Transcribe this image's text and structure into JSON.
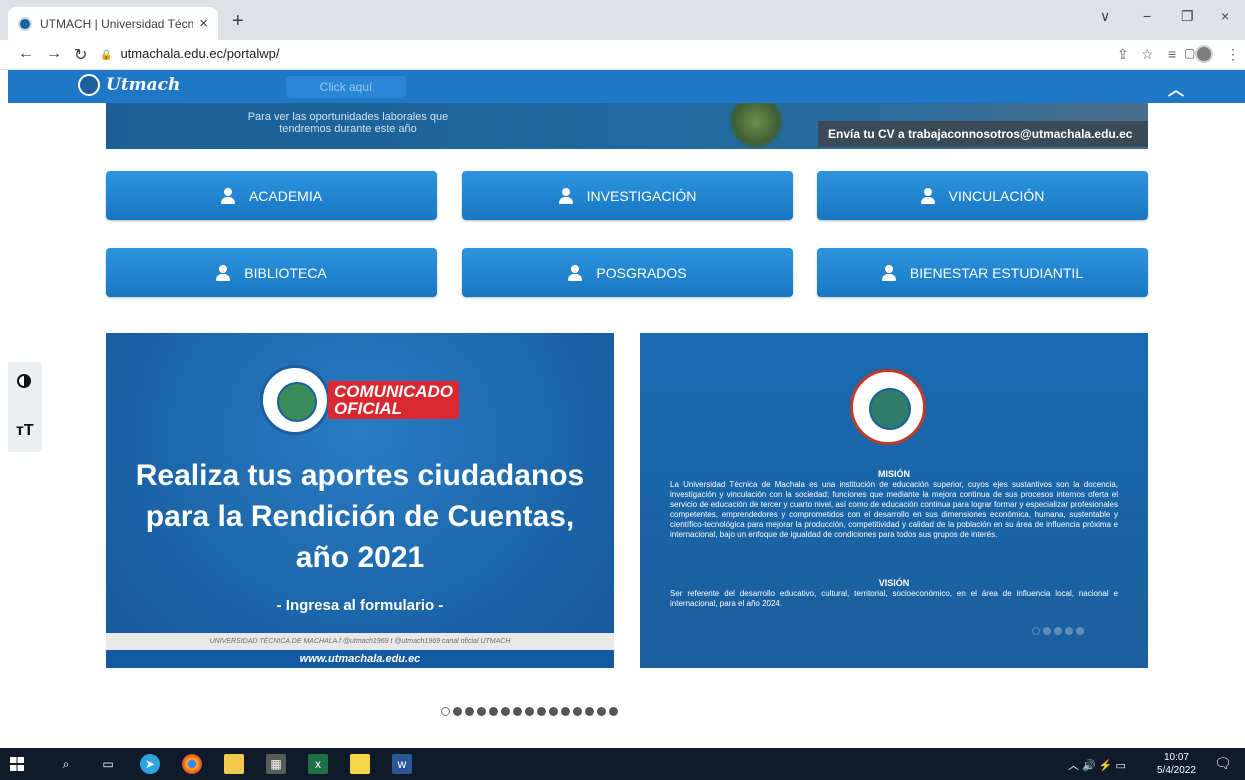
{
  "browser": {
    "tab_title": "UTMACH | Universidad Técnica d",
    "tab_close": "×",
    "new_tab": "+",
    "url": "utmachala.edu.ec/portalwp/",
    "window_controls": [
      "∨",
      "−",
      "❐",
      "×"
    ]
  },
  "site": {
    "logo_text": "Utmach",
    "click_aqui": "Click aquí",
    "collapse_icon": "chevron-up-icon"
  },
  "banner": {
    "text": "Para ver las oportunidades laborales que tendremos durante este año",
    "cv_text": "Envía tu CV a trabajaconnosotros@utmachala.edu.ec"
  },
  "nav_buttons": [
    "ACADEMIA",
    "INVESTIGACIÓN",
    "VINCULACIÓN",
    "BIBLIOTECA",
    "POSGRADOS",
    "BIENESTAR ESTUDIANTIL"
  ],
  "slide_left": {
    "badge_line1": "COMUNICADO",
    "badge_line2": "OFICIAL",
    "title": "Realiza tus aportes ciudadanos para la Rendición de Cuentas, año 2021",
    "subtitle": "- Ingresa al formulario -",
    "footer": "UNIVERSIDAD TÉCNICA DE MACHALA  f  @utmach1969  t  @utmach1969  canal oficial UTMACH",
    "site_url": "www.utmachala.edu.ec"
  },
  "slide_right": {
    "mision_title": "MISIÓN",
    "mision_text": "La Universidad Técnica de Machala es una institución de educación superior, cuyos ejes sustantivos son la docencia, investigación y vinculación con la sociedad; funciones que mediante la mejora continua de sus procesos internos oferta el servicio de educación de tercer y cuarto nivel, así como de educación continua para lograr formar y especializar profesionales competentes, emprendedores y comprometidos con el desarrollo en sus dimensiones económica, humana, sustentable y científico-tecnológica para mejorar la producción, competitividad y calidad de la población en su área de influencia próxima e internacional, bajo un enfoque de igualdad de condiciones para todos sus grupos de interés.",
    "vision_title": "VISIÓN",
    "vision_text": "Ser referente del desarrollo educativo, cultural, territorial, socioeconómico, en el área de influencia local, nacional e internacional, para el año 2024."
  },
  "taskbar": {
    "time": "10:07",
    "date": "5/4/2022"
  }
}
